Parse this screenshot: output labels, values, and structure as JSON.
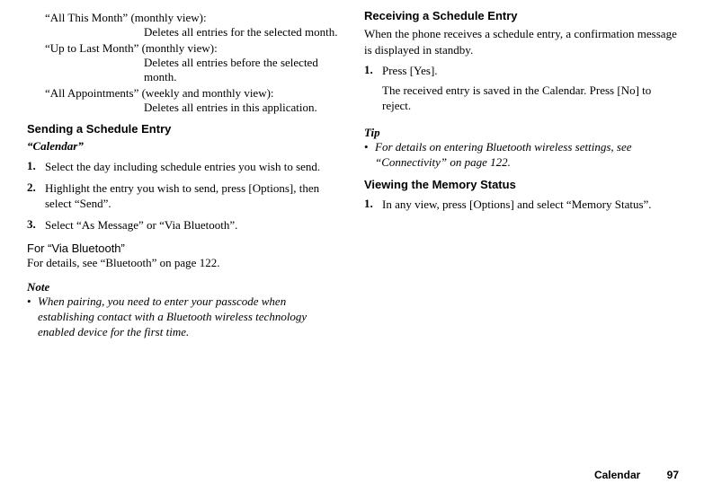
{
  "left": {
    "terms": [
      {
        "label": "“All This Month” (monthly view):",
        "desc": "Deletes all entries for the selected month."
      },
      {
        "label": "“Up to Last Month” (monthly view):",
        "desc": "Deletes all entries before the selected month."
      },
      {
        "label": "“All Appointments” (weekly and monthly view):",
        "desc": "Deletes all entries in this application."
      }
    ],
    "sending_heading": "Sending a Schedule Entry",
    "context": "“Calendar”",
    "steps": [
      {
        "num": "1.",
        "text": "Select the day including schedule entries you wish to send."
      },
      {
        "num": "2.",
        "text": "Highlight the entry you wish to send, press [Options], then select “Send”."
      },
      {
        "num": "3.",
        "text": "Select “As Message” or “Via Bluetooth”."
      }
    ],
    "via_bt_head": "For “Via Bluetooth”",
    "via_bt_body": "For details, see “Bluetooth” on page 122.",
    "note_head": "Note",
    "note_bullet": "When pairing, you need to enter your passcode when establishing contact with a Bluetooth wireless technology enabled device for the first time."
  },
  "right": {
    "recv_heading": "Receiving a Schedule Entry",
    "recv_body1": "When the phone receives a schedule entry, a confirmation message is displayed in standby.",
    "recv_step_num": "1.",
    "recv_step_text": "Press [Yes].",
    "recv_step_sub": "The received entry is saved in the Calendar. Press [No] to reject.",
    "tip_head": "Tip",
    "tip_bullet": "For details on entering Bluetooth wireless settings, see “Connectivity” on page 122.",
    "mem_heading": "Viewing the Memory Status",
    "mem_step_num": "1.",
    "mem_step_text": "In any view, press [Options] and select “Memory Status”."
  },
  "footer": {
    "label": "Calendar",
    "page": "97"
  }
}
